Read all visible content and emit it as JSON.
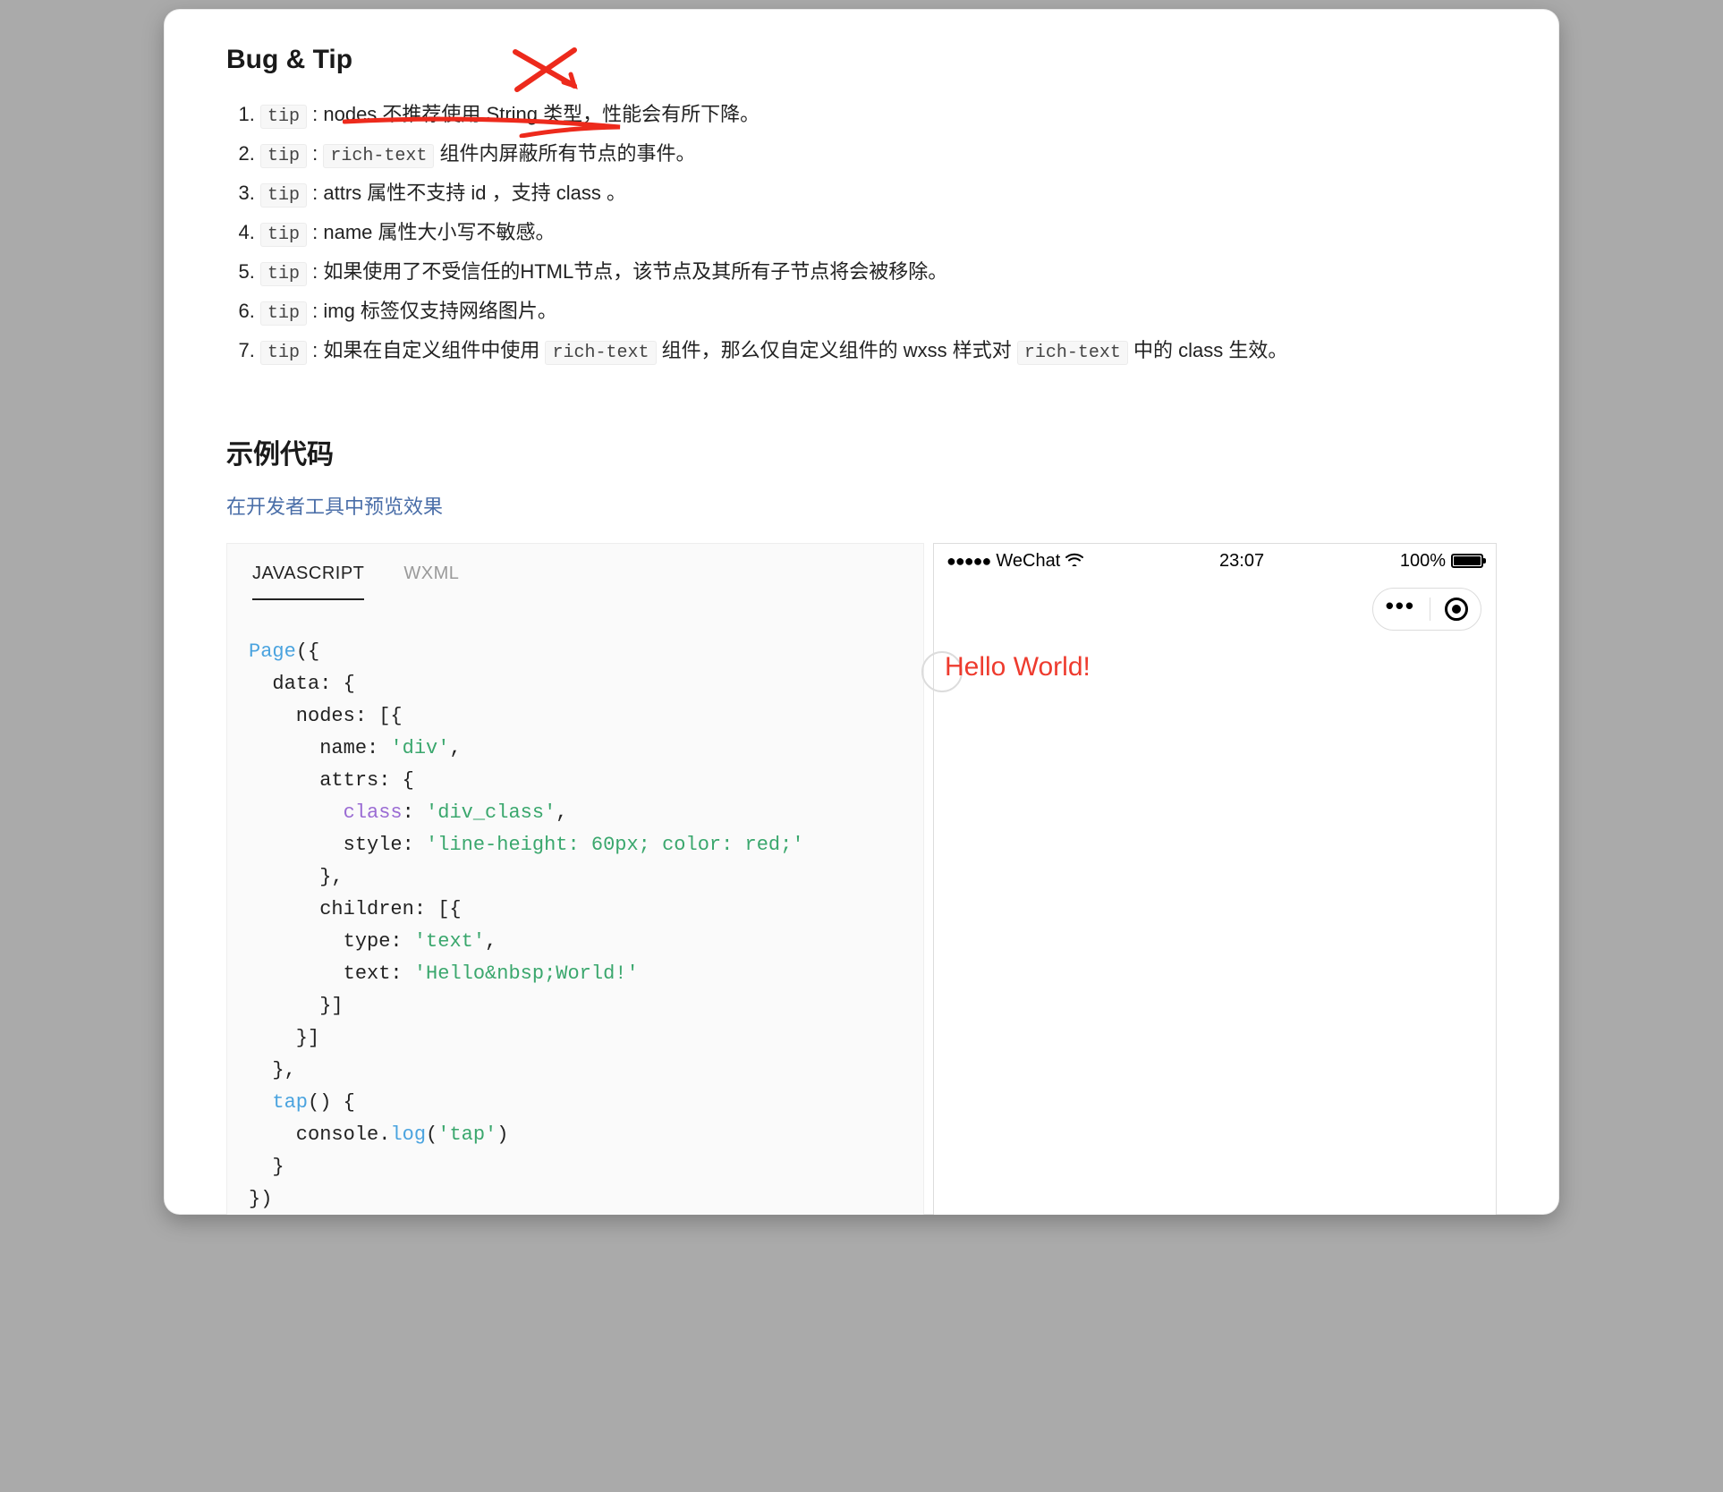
{
  "section_bugtip_title": "Bug & Tip",
  "tips_prefix": "tip",
  "tips": [
    {
      "num": "1.",
      "pre": "nodes ",
      "annot": "不推荐使用 String 类型",
      "post": "，性能会有所下降。"
    },
    {
      "num": "2.",
      "parts": [
        {
          "t": "code",
          "v": "rich-text"
        },
        {
          "t": "text",
          "v": " 组件内屏蔽所有节点的事件。"
        }
      ]
    },
    {
      "num": "3.",
      "parts": [
        {
          "t": "text",
          "v": "attrs 属性不支持 id ，支持 class 。"
        }
      ]
    },
    {
      "num": "4.",
      "parts": [
        {
          "t": "text",
          "v": "name 属性大小写不敏感。"
        }
      ]
    },
    {
      "num": "5.",
      "parts": [
        {
          "t": "text",
          "v": "如果使用了不受信任的HTML节点，该节点及其所有子节点将会被移除。"
        }
      ]
    },
    {
      "num": "6.",
      "parts": [
        {
          "t": "text",
          "v": "img 标签仅支持网络图片。"
        }
      ]
    },
    {
      "num": "7.",
      "parts": [
        {
          "t": "text",
          "v": "如果在自定义组件中使用 "
        },
        {
          "t": "code",
          "v": "rich-text"
        },
        {
          "t": "text",
          "v": " 组件，那么仅自定义组件的 wxss 样式对 "
        },
        {
          "t": "code",
          "v": "rich-text"
        },
        {
          "t": "text",
          "v": " 中的 class 生效。"
        }
      ]
    }
  ],
  "example_title": "示例代码",
  "preview_link_label": "在开发者工具中预览效果",
  "code_tabs": [
    {
      "label": "JAVASCRIPT",
      "active": true
    },
    {
      "label": "WXML",
      "active": false
    }
  ],
  "code_tokens": [
    [
      {
        "c": "fn",
        "v": "Page"
      },
      "({"
    ],
    [
      "  data: {"
    ],
    [
      "    nodes: [{"
    ],
    [
      "      name: ",
      {
        "c": "str",
        "v": "'div'"
      },
      ","
    ],
    [
      "      attrs: {"
    ],
    [
      "        ",
      {
        "c": "key",
        "v": "class"
      },
      ": ",
      {
        "c": "str",
        "v": "'div_class'"
      },
      ","
    ],
    [
      "        style: ",
      {
        "c": "str",
        "v": "'line-height: 60px; color: red;'"
      }
    ],
    [
      "      },"
    ],
    [
      "      children: [{"
    ],
    [
      "        type: ",
      {
        "c": "str",
        "v": "'text'"
      },
      ","
    ],
    [
      "        text: ",
      {
        "c": "str",
        "v": "'Hello&nbsp;World!'"
      }
    ],
    [
      "      }]"
    ],
    [
      "    }]"
    ],
    [
      "  },"
    ],
    [
      "  ",
      {
        "c": "fn",
        "v": "tap"
      },
      "() {"
    ],
    [
      "    console.",
      {
        "c": "fn",
        "v": "log"
      },
      "(",
      {
        "c": "str",
        "v": "'tap'"
      },
      ")"
    ],
    [
      "  }"
    ],
    [
      "})"
    ]
  ],
  "phone": {
    "carrier": "WeChat",
    "time": "23:07",
    "battery": "100%",
    "hello": "Hello World!"
  },
  "annotation_color": "#ed2a1c"
}
